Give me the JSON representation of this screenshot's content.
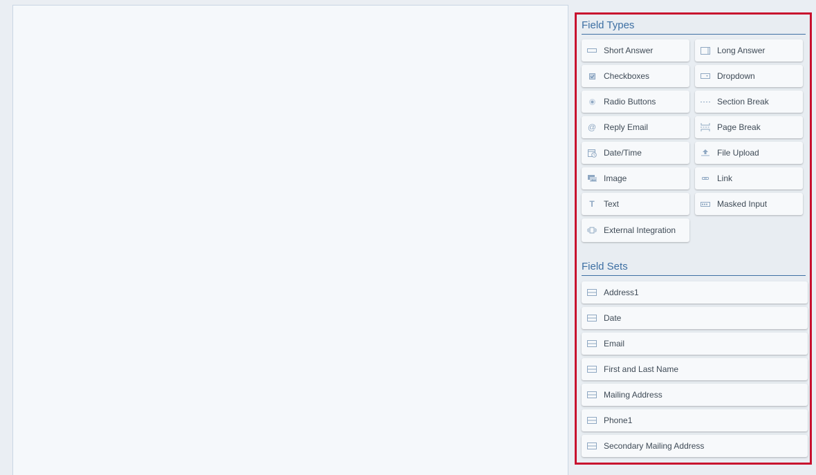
{
  "field_types": {
    "title": "Field Types",
    "items": [
      {
        "label": "Short Answer",
        "icon": "short-answer-icon"
      },
      {
        "label": "Long Answer",
        "icon": "long-answer-icon"
      },
      {
        "label": "Checkboxes",
        "icon": "checkbox-icon"
      },
      {
        "label": "Dropdown",
        "icon": "dropdown-icon"
      },
      {
        "label": "Radio Buttons",
        "icon": "radio-icon"
      },
      {
        "label": "Section Break",
        "icon": "section-break-icon"
      },
      {
        "label": "Reply Email",
        "icon": "at-sign-icon"
      },
      {
        "label": "Page Break",
        "icon": "page-break-icon"
      },
      {
        "label": "Date/Time",
        "icon": "calendar-clock-icon"
      },
      {
        "label": "File Upload",
        "icon": "upload-icon"
      },
      {
        "label": "Image",
        "icon": "image-icon"
      },
      {
        "label": "Link",
        "icon": "link-icon"
      },
      {
        "label": "Text",
        "icon": "text-icon"
      },
      {
        "label": "Masked Input",
        "icon": "masked-input-icon"
      },
      {
        "label": "External Integration",
        "icon": "integration-icon"
      }
    ]
  },
  "field_sets": {
    "title": "Field Sets",
    "items": [
      {
        "label": "Address1"
      },
      {
        "label": "Date"
      },
      {
        "label": "Email"
      },
      {
        "label": "First and Last Name"
      },
      {
        "label": "Mailing Address"
      },
      {
        "label": "Phone1"
      },
      {
        "label": "Secondary Mailing Address"
      }
    ]
  },
  "colors": {
    "accent": "#3d6fa3",
    "highlight_border": "#c8102e",
    "icon": "#8ea7c2"
  }
}
